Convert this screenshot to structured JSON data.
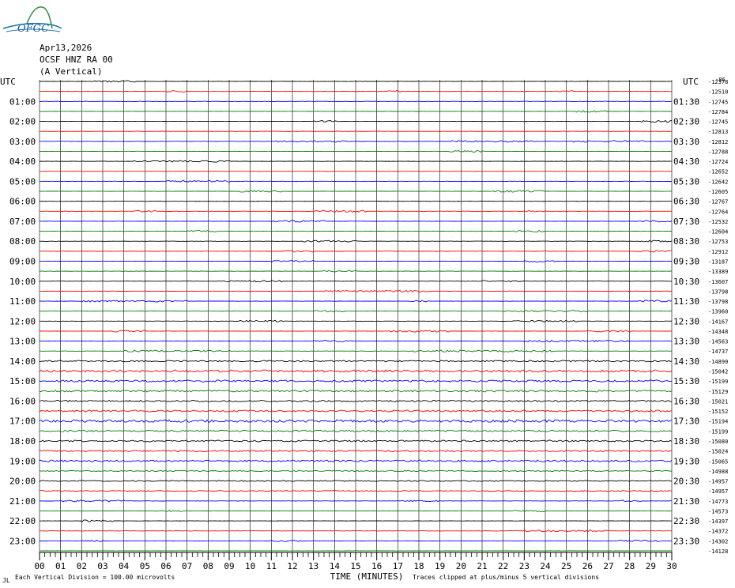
{
  "header": {
    "logo_text": "OFGC",
    "date": "Apr13,2026",
    "station": "OCSF HNZ RA 00",
    "component": "(A Vertical)"
  },
  "chart_data": {
    "type": "line",
    "title": "",
    "xlabel": "TIME (MINUTES)",
    "xlim": [
      0,
      30
    ],
    "x_ticks": [
      "00",
      "01",
      "02",
      "03",
      "04",
      "05",
      "06",
      "07",
      "08",
      "09",
      "10",
      "11",
      "12",
      "13",
      "14",
      "15",
      "16",
      "17",
      "18",
      "19",
      "20",
      "21",
      "22",
      "23",
      "24",
      "25",
      "26",
      "27",
      "28",
      "29",
      "30"
    ],
    "grid": true,
    "left_axis_title": "UTC",
    "right_axis_title": "UTC",
    "left_hour_labels": [
      "01:00",
      "02:00",
      "03:00",
      "04:00",
      "05:00",
      "06:00",
      "07:00",
      "08:00",
      "09:00",
      "10:00",
      "11:00",
      "12:00",
      "13:00",
      "14:00",
      "15:00",
      "16:00",
      "17:00",
      "18:00",
      "19:00",
      "20:00",
      "21:00",
      "22:00",
      "23:00"
    ],
    "right_hour_labels": [
      "01:30",
      "02:30",
      "03:30",
      "04:30",
      "05:30",
      "06:30",
      "07:30",
      "08:30",
      "09:30",
      "10:30",
      "11:30",
      "12:30",
      "13:30",
      "14:30",
      "15:30",
      "16:30",
      "17:30",
      "18:30",
      "19:30",
      "20:30",
      "21:30",
      "22:30",
      "23:30"
    ],
    "trace_colors": [
      "#000000",
      "#ff0000",
      "#0000ff",
      "#008000"
    ],
    "trace_offsets": [
      "-12378",
      "-12510",
      "-12745",
      "-12784",
      "-12745",
      "-12813",
      "-12812",
      "-12788",
      "-12724",
      "-12652",
      "-12642",
      "-12605",
      "-12767",
      "-12764",
      "-12532",
      "-12604",
      "-12753",
      "-12912",
      "-13187",
      "-13389",
      "-13607",
      "-13798",
      "-13798",
      "-13960",
      "-14167",
      "-14348",
      "-14563",
      "-14737",
      "-14890",
      "-15042",
      "-15199",
      "-15129",
      "-15021",
      "-15152",
      "-15194",
      "-15199",
      "-15080",
      "-15024",
      "-15065",
      "-14988",
      "-14957",
      "-14957",
      "-14773",
      "-14573",
      "-14397",
      "-14372",
      "-14302",
      "-14128"
    ],
    "top_right_label": "-86",
    "scale_note": "Each Vertical Division =  100.00 microvolts",
    "clip_note": "Traces clipped at plus/minus 5 vertical divisions",
    "corner_mark": "JL",
    "activity": [
      {
        "trace": 0,
        "x": 2.5,
        "w": 2.0,
        "amp": 1.0
      },
      {
        "trace": 1,
        "x": 6.0,
        "w": 1.0,
        "amp": 1.0
      },
      {
        "trace": 1,
        "x": 16.5,
        "w": 0.8,
        "amp": 1.0
      },
      {
        "trace": 1,
        "x": 24.5,
        "w": 0.8,
        "amp": 1.0
      },
      {
        "trace": 3,
        "x": 25.5,
        "w": 1.5,
        "amp": 1.0
      },
      {
        "trace": 4,
        "x": 13.0,
        "w": 1.2,
        "amp": 1.0
      },
      {
        "trace": 4,
        "x": 28.5,
        "w": 1.6,
        "amp": 1.2
      },
      {
        "trace": 6,
        "x": 11.2,
        "w": 3.5,
        "amp": 1.0
      },
      {
        "trace": 6,
        "x": 19.5,
        "w": 4.0,
        "amp": 1.0
      },
      {
        "trace": 6,
        "x": 25.2,
        "w": 3.5,
        "amp": 1.0
      },
      {
        "trace": 7,
        "x": 19.5,
        "w": 1.5,
        "amp": 1.0
      },
      {
        "trace": 8,
        "x": 4.5,
        "w": 4.5,
        "amp": 1.0
      },
      {
        "trace": 10,
        "x": 6.0,
        "w": 3.0,
        "amp": 1.0
      },
      {
        "trace": 11,
        "x": 9.5,
        "w": 2.0,
        "amp": 1.0
      },
      {
        "trace": 11,
        "x": 21.5,
        "w": 2.5,
        "amp": 1.0
      },
      {
        "trace": 13,
        "x": 4.5,
        "w": 1.0,
        "amp": 1.0
      },
      {
        "trace": 13,
        "x": 13.0,
        "w": 2.5,
        "amp": 1.0
      },
      {
        "trace": 13,
        "x": 23.0,
        "w": 1.0,
        "amp": 1.0
      },
      {
        "trace": 14,
        "x": 11.0,
        "w": 2.5,
        "amp": 1.0
      },
      {
        "trace": 14,
        "x": 28.5,
        "w": 1.5,
        "amp": 1.0
      },
      {
        "trace": 15,
        "x": 7.0,
        "w": 1.5,
        "amp": 1.0
      },
      {
        "trace": 15,
        "x": 22.5,
        "w": 1.5,
        "amp": 1.0
      },
      {
        "trace": 16,
        "x": 12.5,
        "w": 2.5,
        "amp": 1.0
      },
      {
        "trace": 16,
        "x": 28.5,
        "w": 1.5,
        "amp": 1.0
      },
      {
        "trace": 17,
        "x": 11.5,
        "w": 1.5,
        "amp": 1.0
      },
      {
        "trace": 17,
        "x": 28.5,
        "w": 1.5,
        "amp": 1.0
      },
      {
        "trace": 18,
        "x": 11.0,
        "w": 2.0,
        "amp": 1.0
      },
      {
        "trace": 18,
        "x": 23.0,
        "w": 1.5,
        "amp": 1.0
      },
      {
        "trace": 19,
        "x": 13.5,
        "w": 1.5,
        "amp": 1.0
      },
      {
        "trace": 20,
        "x": 8.5,
        "w": 3.0,
        "amp": 1.0
      },
      {
        "trace": 20,
        "x": 21.0,
        "w": 2.0,
        "amp": 1.0
      },
      {
        "trace": 21,
        "x": 13.5,
        "w": 5.0,
        "amp": 1.0
      },
      {
        "trace": 22,
        "x": 2.0,
        "w": 5.0,
        "amp": 1.0
      },
      {
        "trace": 22,
        "x": 17.5,
        "w": 1.0,
        "amp": 1.0
      },
      {
        "trace": 22,
        "x": 28.5,
        "w": 1.5,
        "amp": 1.0
      },
      {
        "trace": 23,
        "x": 13.0,
        "w": 1.5,
        "amp": 1.0
      },
      {
        "trace": 23,
        "x": 22.0,
        "w": 4.0,
        "amp": 1.0
      },
      {
        "trace": 24,
        "x": 9.5,
        "w": 2.0,
        "amp": 1.0
      },
      {
        "trace": 24,
        "x": 22.5,
        "w": 3.0,
        "amp": 1.0
      },
      {
        "trace": 25,
        "x": 3.5,
        "w": 1.5,
        "amp": 1.0
      },
      {
        "trace": 25,
        "x": 16.5,
        "w": 3.0,
        "amp": 1.0
      },
      {
        "trace": 25,
        "x": 26.0,
        "w": 2.0,
        "amp": 1.0
      },
      {
        "trace": 26,
        "x": 13.0,
        "w": 2.0,
        "amp": 1.0
      },
      {
        "trace": 26,
        "x": 23.0,
        "w": 5.0,
        "amp": 1.0
      },
      {
        "trace": 27,
        "x": 4.0,
        "w": 5.0,
        "amp": 1.0
      },
      {
        "trace": 27,
        "x": 17.5,
        "w": 7.0,
        "amp": 1.0
      },
      {
        "trace": 28,
        "x": 0.0,
        "w": 30.0,
        "amp": 0.8
      },
      {
        "trace": 29,
        "x": 0.0,
        "w": 30.0,
        "amp": 1.3
      },
      {
        "trace": 30,
        "x": 0.0,
        "w": 30.0,
        "amp": 1.1
      },
      {
        "trace": 31,
        "x": 0.0,
        "w": 30.0,
        "amp": 1.0
      },
      {
        "trace": 32,
        "x": 0.0,
        "w": 30.0,
        "amp": 0.9
      },
      {
        "trace": 33,
        "x": 0.0,
        "w": 30.0,
        "amp": 1.0
      },
      {
        "trace": 34,
        "x": 0.0,
        "w": 30.0,
        "amp": 1.4
      },
      {
        "trace": 35,
        "x": 0.0,
        "w": 30.0,
        "amp": 0.9
      },
      {
        "trace": 36,
        "x": 0.0,
        "w": 30.0,
        "amp": 0.9
      },
      {
        "trace": 37,
        "x": 0.0,
        "w": 30.0,
        "amp": 0.8
      },
      {
        "trace": 38,
        "x": 0.0,
        "w": 30.0,
        "amp": 1.0
      },
      {
        "trace": 39,
        "x": 0.0,
        "w": 30.0,
        "amp": 0.6
      },
      {
        "trace": 40,
        "x": 0.0,
        "w": 30.0,
        "amp": 0.6
      },
      {
        "trace": 41,
        "x": 0.0,
        "w": 30.0,
        "amp": 0.5
      },
      {
        "trace": 42,
        "x": 1.0,
        "w": 3.0,
        "amp": 1.0
      },
      {
        "trace": 42,
        "x": 17.0,
        "w": 2.0,
        "amp": 1.0
      },
      {
        "trace": 42,
        "x": 27.5,
        "w": 1.0,
        "amp": 1.0
      },
      {
        "trace": 43,
        "x": 5.5,
        "w": 1.5,
        "amp": 1.0
      },
      {
        "trace": 43,
        "x": 22.5,
        "w": 1.5,
        "amp": 1.0
      },
      {
        "trace": 44,
        "x": 2.0,
        "w": 1.5,
        "amp": 1.0
      },
      {
        "trace": 45,
        "x": 23.0,
        "w": 4.0,
        "amp": 1.0
      },
      {
        "trace": 46,
        "x": 2.0,
        "w": 1.0,
        "amp": 1.0
      },
      {
        "trace": 46,
        "x": 11.0,
        "w": 1.5,
        "amp": 1.0
      },
      {
        "trace": 46,
        "x": 27.5,
        "w": 2.0,
        "amp": 1.0
      }
    ]
  }
}
